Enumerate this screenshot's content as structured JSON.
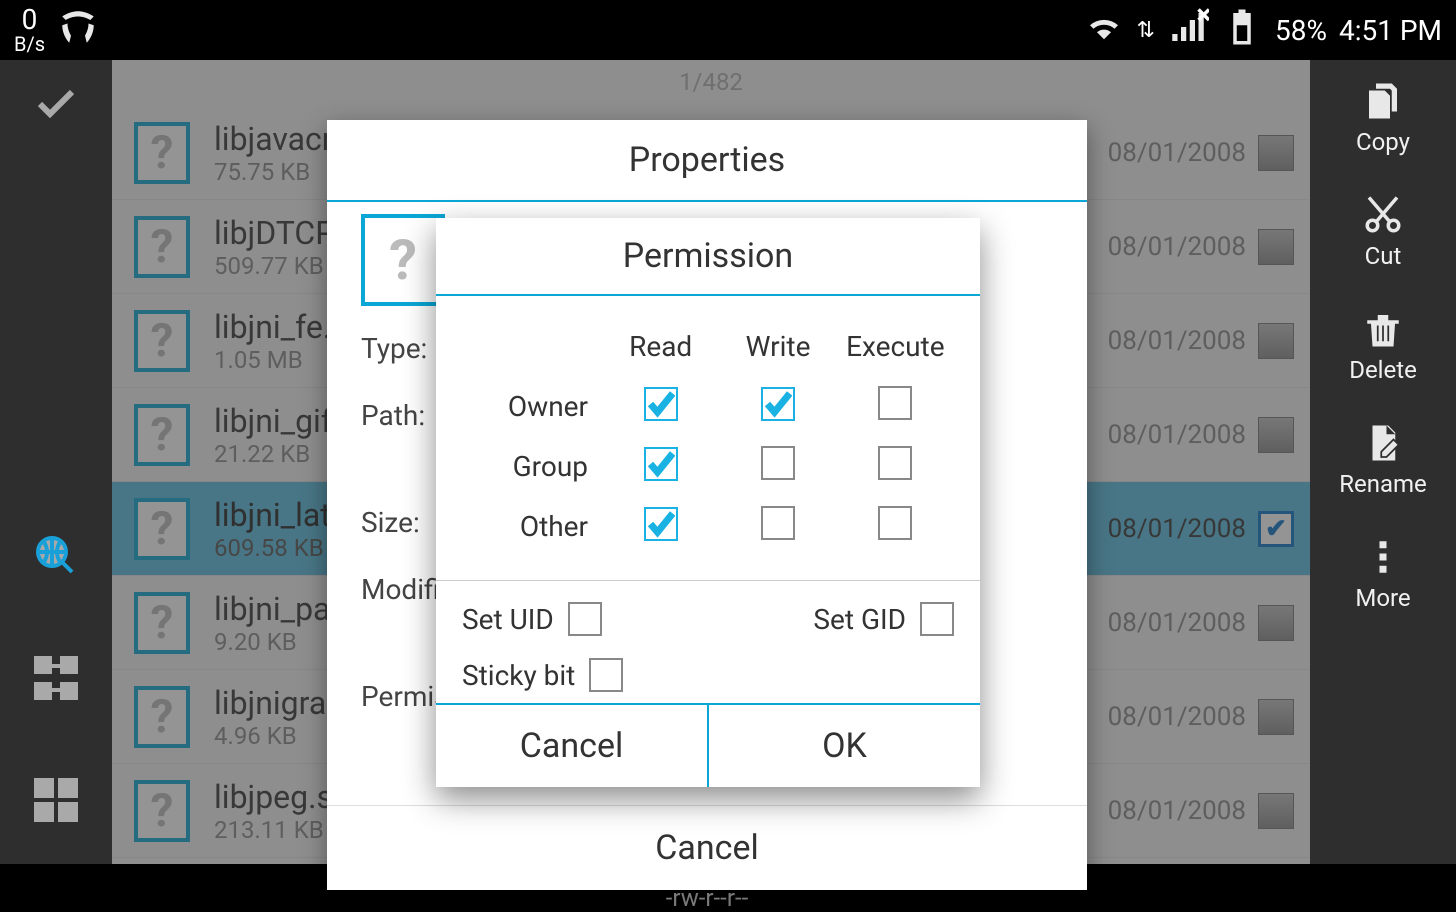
{
  "statusbar": {
    "speed_num": "0",
    "speed_unit": "B/s",
    "battery": "58%",
    "time": "4:51 PM"
  },
  "counter": "1/482",
  "files": [
    {
      "name": "libjavacr",
      "size": "75.75 KB",
      "date": "08/01/2008",
      "selected": false
    },
    {
      "name": "libjDTCP",
      "size": "509.77 KB",
      "date": "08/01/2008",
      "selected": false
    },
    {
      "name": "libjni_fe.",
      "size": "1.05 MB",
      "date": "08/01/2008",
      "selected": false
    },
    {
      "name": "libjni_gif",
      "size": "21.22 KB",
      "date": "08/01/2008",
      "selected": false
    },
    {
      "name": "libjni_lat",
      "size": "609.58 KB",
      "date": "08/01/2008",
      "selected": true
    },
    {
      "name": "libjni_pa",
      "size": "9.20 KB",
      "date": "08/01/2008",
      "selected": false
    },
    {
      "name": "libjnigrap",
      "size": "4.96 KB",
      "date": "08/01/2008",
      "selected": false
    },
    {
      "name": "libjpeg.s",
      "size": "213.11 KB",
      "date": "08/01/2008",
      "selected": false
    }
  ],
  "rightbar": {
    "copy": "Copy",
    "cut": "Cut",
    "delete": "Delete",
    "rename": "Rename",
    "more": "More"
  },
  "properties": {
    "title": "Properties",
    "labels": {
      "type": "Type:",
      "path": "Path:",
      "size": "Size:",
      "modified": "Modifie",
      "perm": "Permis:"
    },
    "cancel": "Cancel",
    "perm_string": "-rw-r--r--"
  },
  "permission": {
    "title": "Permission",
    "cols": {
      "read": "Read",
      "write": "Write",
      "execute": "Execute"
    },
    "rows": {
      "owner": "Owner",
      "group": "Group",
      "other": "Other",
      "setuid": "Set UID",
      "setgid": "Set GID",
      "sticky": "Sticky bit"
    },
    "values": {
      "owner": {
        "read": true,
        "write": true,
        "execute": false
      },
      "group": {
        "read": true,
        "write": false,
        "execute": false
      },
      "other": {
        "read": true,
        "write": false,
        "execute": false
      },
      "setuid": false,
      "setgid": false,
      "sticky": false
    },
    "buttons": {
      "cancel": "Cancel",
      "ok": "OK"
    }
  }
}
